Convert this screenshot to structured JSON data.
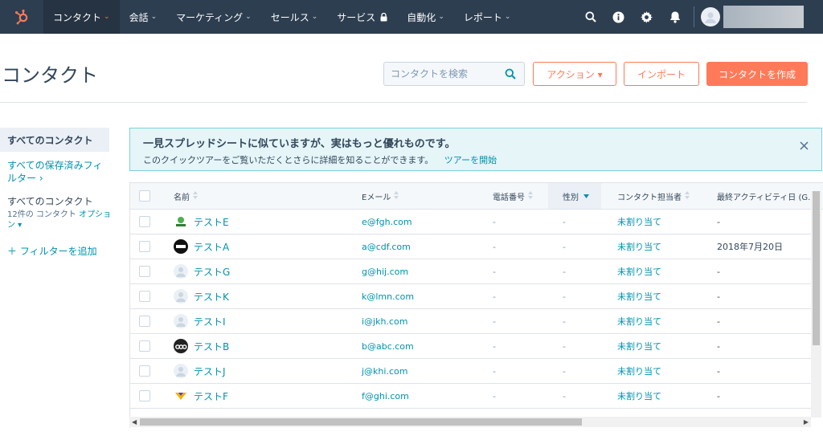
{
  "nav": {
    "items": [
      {
        "label": "コンタクト",
        "active": true,
        "chevron": true
      },
      {
        "label": "会話",
        "chevron": true
      },
      {
        "label": "マーケティング",
        "chevron": true
      },
      {
        "label": "セールス",
        "chevron": true
      },
      {
        "label": "サービス",
        "lock": true
      },
      {
        "label": "自動化",
        "chevron": true
      },
      {
        "label": "レポート",
        "chevron": true
      }
    ],
    "icons": [
      "search-icon",
      "info-icon",
      "gear-icon",
      "bell-icon"
    ],
    "chevron_glyph": "⌄",
    "brand_color": "#ff7a59",
    "bar_color": "#2d3e50"
  },
  "header": {
    "title": "コンタクト",
    "search_placeholder": "コンタクトを検索",
    "actions_label": "アクション ▾",
    "import_label": "インポート",
    "create_label": "コンタクトを作成"
  },
  "sidebar": {
    "all_contacts": "すべてのコンタクト",
    "all_saved_filters": "すべての保存済みフィルター ›",
    "current_view_title": "すべてのコンタクト",
    "current_view_count": "12件の コンタクト",
    "options_label": "オプション ▾",
    "add_filter": "＋ フィルターを追加"
  },
  "banner": {
    "title": "一見スプレッドシートに似ていますが、実はもっと優れものです。",
    "text": "このクイックツアーをご覧いただくとさらに詳細を知ることができます。",
    "link": "ツアーを開始"
  },
  "table": {
    "columns": [
      "名前",
      "Eメール",
      "電話番号",
      "性別",
      "コンタクト担当者",
      "最終アクティビティ日 (G..."
    ],
    "sorted_column": "性別",
    "rows": [
      {
        "name": "テストE",
        "email": "e@fgh.com",
        "phone": "-",
        "gender": "-",
        "owner": "未割り当て",
        "last_activity": "-",
        "avatar": "green-logo"
      },
      {
        "name": "テストA",
        "email": "a@cdf.com",
        "phone": "-",
        "gender": "-",
        "owner": "未割り当て",
        "last_activity": "2018年7月20日",
        "avatar": "cdf-logo"
      },
      {
        "name": "テストG",
        "email": "g@hij.com",
        "phone": "-",
        "gender": "-",
        "owner": "未割り当て",
        "last_activity": "-",
        "avatar": "default"
      },
      {
        "name": "テストK",
        "email": "k@lmn.com",
        "phone": "-",
        "gender": "-",
        "owner": "未割り当て",
        "last_activity": "-",
        "avatar": "default"
      },
      {
        "name": "テストI",
        "email": "i@jkh.com",
        "phone": "-",
        "gender": "-",
        "owner": "未割り当て",
        "last_activity": "-",
        "avatar": "default"
      },
      {
        "name": "テストB",
        "email": "b@abc.com",
        "phone": "-",
        "gender": "-",
        "owner": "未割り当て",
        "last_activity": "-",
        "avatar": "abc-logo"
      },
      {
        "name": "テストJ",
        "email": "j@khi.com",
        "phone": "-",
        "gender": "-",
        "owner": "未割り当て",
        "last_activity": "-",
        "avatar": "default"
      },
      {
        "name": "テストF",
        "email": "f@ghi.com",
        "phone": "-",
        "gender": "-",
        "owner": "未割り当て",
        "last_activity": "-",
        "avatar": "yellow-logo"
      }
    ]
  }
}
